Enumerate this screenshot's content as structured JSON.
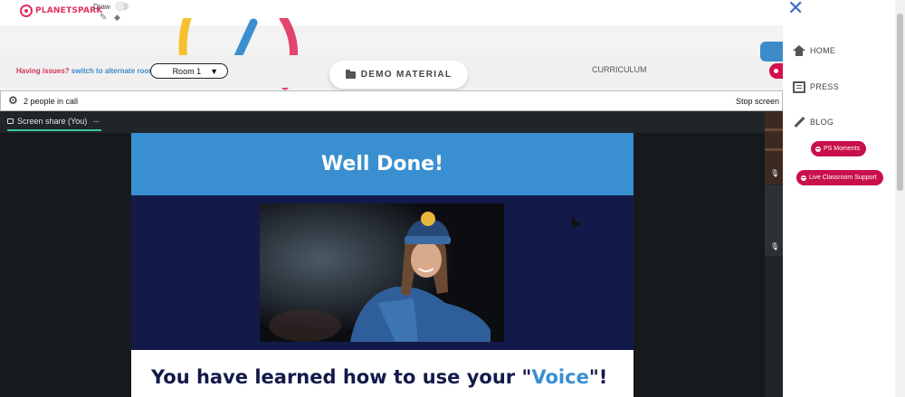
{
  "header": {
    "logo_text": "PLANETSPARK",
    "draw_label": "Draw",
    "draw_enabled": false,
    "tools": [
      "pencil-icon",
      "eraser-icon"
    ]
  },
  "room_bar": {
    "issues_text": "Having issues?",
    "alternate_link": "switch to alternate room",
    "room_selected": "Room 1",
    "demo_material": "DEMO MATERIAL",
    "curriculum": "CURRICULUM"
  },
  "call": {
    "people_count": "2 people in call",
    "stop_screen": "Stop screen",
    "share_tab": "Screen share (You)",
    "more": "···"
  },
  "slide": {
    "title": "Well Done!",
    "footer_prefix": "You have learned how to use your \"",
    "footer_highlight": "Voice",
    "footer_suffix": "\"!"
  },
  "right_panel": {
    "nav": [
      {
        "label": "HOME",
        "icon": "home-icon"
      },
      {
        "label": "PRESS",
        "icon": "press-icon"
      },
      {
        "label": "BLOG",
        "icon": "blog-icon"
      }
    ],
    "ps_moments": "PS Moments",
    "live_support": "Live Classroom Support"
  },
  "colors": {
    "brand": "#e0315e",
    "accent_blue": "#3a8fd0",
    "slide_navy": "#131a4a",
    "pill_red": "#c8104b",
    "share_underline": "#37c9a1"
  }
}
